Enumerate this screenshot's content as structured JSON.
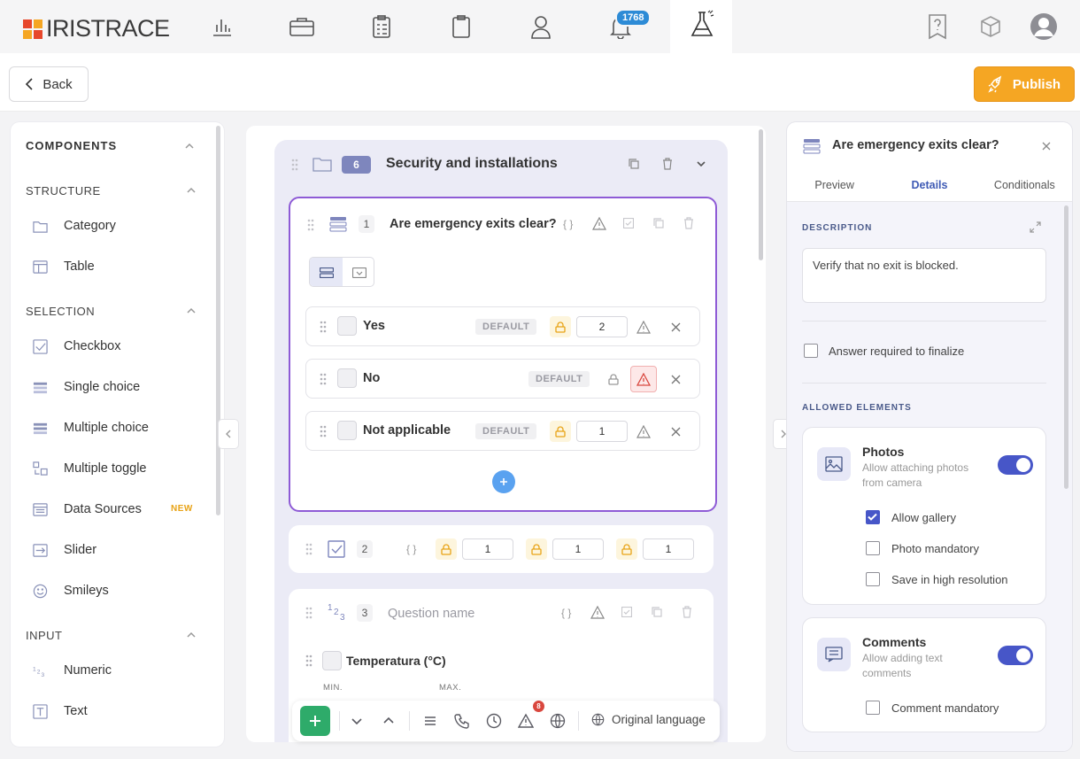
{
  "app": {
    "name": "IRISTRACE",
    "notifications_count": "1768"
  },
  "toolbar": {
    "back_label": "Back",
    "publish_label": "Publish"
  },
  "components": {
    "title": "COMPONENTS",
    "sections": {
      "structure": "STRUCTURE",
      "selection": "SELECTION",
      "input": "INPUT"
    },
    "structure_items": [
      "Category",
      "Table"
    ],
    "selection_items": [
      "Checkbox",
      "Single choice",
      "Multiple choice",
      "Multiple toggle",
      "Data Sources",
      "Slider",
      "Smileys"
    ],
    "input_items": [
      "Numeric",
      "Text"
    ],
    "new_badge": "NEW"
  },
  "category": {
    "number": "6",
    "title": "Security and installations"
  },
  "question1": {
    "index": "1",
    "title": "Are emergency exits clear?",
    "options": [
      {
        "label": "Yes",
        "default": "DEFAULT",
        "value": "2"
      },
      {
        "label": "No",
        "default": "DEFAULT",
        "value": ""
      },
      {
        "label": "Not applicable",
        "default": "DEFAULT",
        "value": "1"
      }
    ]
  },
  "question2": {
    "index": "2",
    "values": [
      "1",
      "1",
      "1"
    ]
  },
  "question3": {
    "index": "3",
    "placeholder": "Question name",
    "sub_label": "Temperatura (°C)",
    "min_label": "MIN.",
    "max_label": "MAX."
  },
  "bottombar": {
    "warning_count": "8",
    "language": "Original language"
  },
  "details": {
    "title": "Are emergency exits clear?",
    "tabs": [
      "Preview",
      "Details",
      "Conditionals"
    ],
    "active_tab": "Details",
    "description_label": "DESCRIPTION",
    "description": "Verify that no exit is blocked.",
    "required_label": "Answer required to finalize",
    "allowed_label": "ALLOWED ELEMENTS",
    "photos": {
      "title": "Photos",
      "subtitle": "Allow attaching photos from camera",
      "enabled": true,
      "options": [
        {
          "label": "Allow gallery",
          "checked": true
        },
        {
          "label": "Photo mandatory",
          "checked": false
        },
        {
          "label": "Save in high resolution",
          "checked": false
        }
      ]
    },
    "comments": {
      "title": "Comments",
      "subtitle": "Allow adding text comments",
      "enabled": true,
      "options": [
        {
          "label": "Comment mandatory",
          "checked": false
        }
      ]
    }
  },
  "colors": {
    "accent": "#4756c8",
    "publish": "#f5a623",
    "selected_border": "#8e5bd6",
    "add": "#2eab6a"
  }
}
